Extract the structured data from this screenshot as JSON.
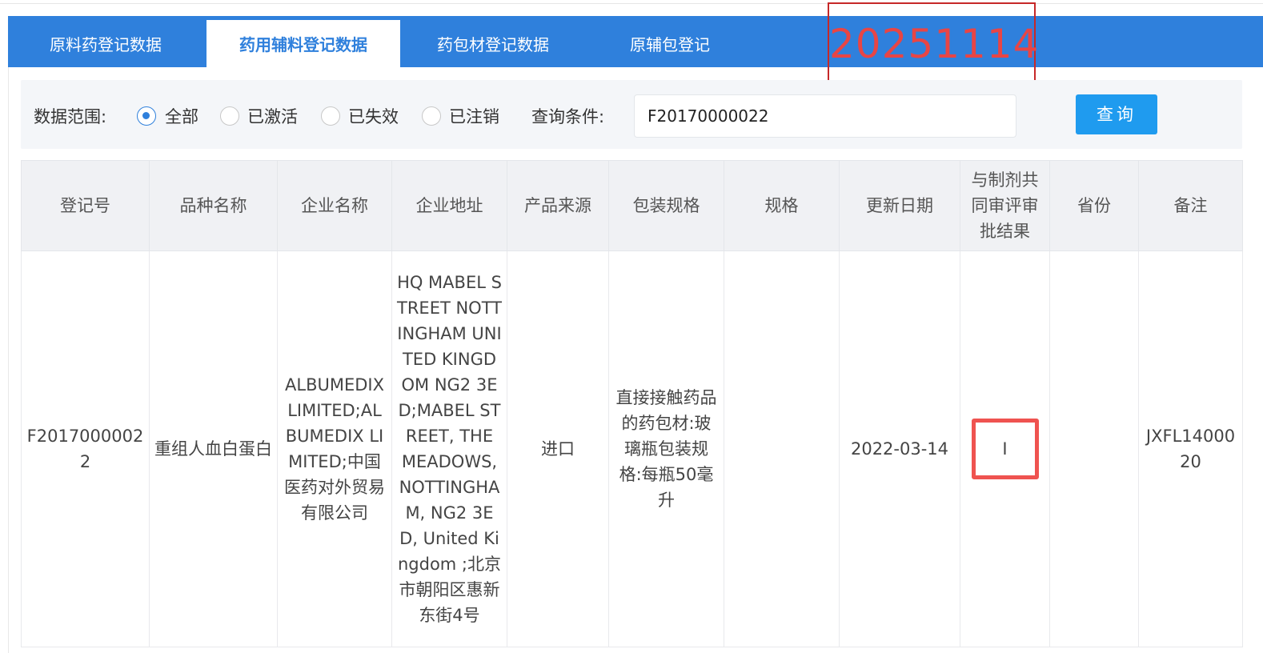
{
  "tabs": [
    {
      "label": "原料药登记数据",
      "active": false
    },
    {
      "label": "药用辅料登记数据",
      "active": true
    },
    {
      "label": "药包材登记数据",
      "active": false
    },
    {
      "label": "原辅包登记",
      "active": false
    }
  ],
  "stamp": "20251114",
  "filter": {
    "scope_label": "数据范围:",
    "options": [
      {
        "label": "全部",
        "checked": true
      },
      {
        "label": "已激活",
        "checked": false
      },
      {
        "label": "已失效",
        "checked": false
      },
      {
        "label": "已注销",
        "checked": false
      }
    ],
    "query_label": "查询条件:",
    "query_value": "F20170000022",
    "search_button": "查询"
  },
  "table": {
    "headers": [
      "登记号",
      "品种名称",
      "企业名称",
      "企业地址",
      "产品来源",
      "包装规格",
      "规格",
      "更新日期",
      "与制剂共同审评审批结果",
      "省份",
      "备注"
    ],
    "rows": [
      {
        "reg_no": "F20170000022",
        "product_name": "重组人血白蛋白",
        "company": "ALBUMEDIX LIMITED;ALBUMEDIX LIMITED;中国医药对外贸易有限公司",
        "address": "HQ MABEL STREET NOTTINGHAM UNITED KINGDOM NG2 3ED;MABEL STREET, THE MEADOWS, NOTTINGHAM, NG2 3ED, United Kingdom ;北京市朝阳区惠新东街4号",
        "source": "进口",
        "packaging": "直接接触药品的药包材:玻璃瓶包装规格:每瓶50毫升",
        "spec": "",
        "update_date": "2022-03-14",
        "review_result": "I",
        "province": "",
        "remark": "JXFL1400020"
      }
    ]
  },
  "colors": {
    "tab_bar": "#2f80dc",
    "query_button": "#1f9bef",
    "highlight": "#ef5350",
    "stamp": "#e84545"
  }
}
